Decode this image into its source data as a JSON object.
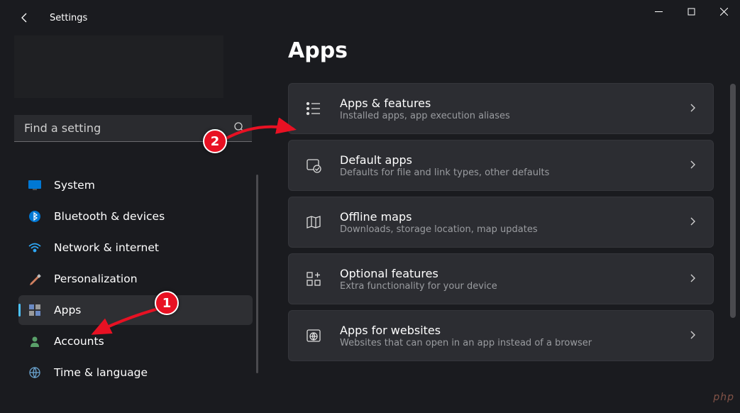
{
  "header": {
    "title": "Settings",
    "search_placeholder": "Find a setting"
  },
  "page": {
    "title": "Apps"
  },
  "sidebar": {
    "items": [
      {
        "label": "System",
        "icon": "system"
      },
      {
        "label": "Bluetooth & devices",
        "icon": "bluetooth"
      },
      {
        "label": "Network & internet",
        "icon": "wifi"
      },
      {
        "label": "Personalization",
        "icon": "personalization"
      },
      {
        "label": "Apps",
        "icon": "apps"
      },
      {
        "label": "Accounts",
        "icon": "accounts"
      },
      {
        "label": "Time & language",
        "icon": "time"
      }
    ],
    "selected_index": 4
  },
  "cards": [
    {
      "title": "Apps & features",
      "subtitle": "Installed apps, app execution aliases",
      "icon": "apps-list"
    },
    {
      "title": "Default apps",
      "subtitle": "Defaults for file and link types, other defaults",
      "icon": "default-apps"
    },
    {
      "title": "Offline maps",
      "subtitle": "Downloads, storage location, map updates",
      "icon": "map"
    },
    {
      "title": "Optional features",
      "subtitle": "Extra functionality for your device",
      "icon": "optional"
    },
    {
      "title": "Apps for websites",
      "subtitle": "Websites that can open in an app instead of a browser",
      "icon": "globe"
    }
  ],
  "annotations": {
    "badge1": "1",
    "badge2": "2"
  },
  "watermark": "php"
}
